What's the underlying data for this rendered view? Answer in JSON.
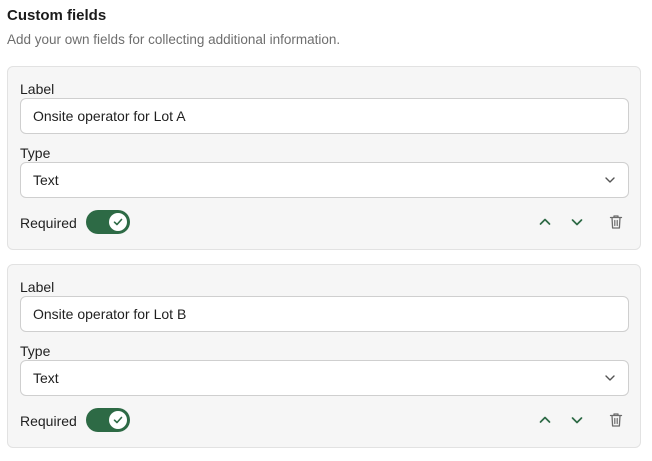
{
  "header": {
    "title": "Custom fields",
    "description": "Add your own fields for collecting additional information."
  },
  "colors": {
    "accent": "#2d6a45",
    "card_bg": "#f6f6f6",
    "border": "#cfcfcf"
  },
  "fields": [
    {
      "label_caption": "Label",
      "label_value": "Onsite operator for Lot A",
      "type_caption": "Type",
      "type_value": "Text",
      "required_caption": "Required",
      "required": true
    },
    {
      "label_caption": "Label",
      "label_value": "Onsite operator for Lot B",
      "type_caption": "Type",
      "type_value": "Text",
      "required_caption": "Required",
      "required": true
    }
  ],
  "icons": {
    "select_arrow": "chevron-down-icon",
    "move_up": "chevron-up-icon",
    "move_down": "chevron-down-icon",
    "delete": "trash-icon",
    "toggle_check": "check-icon"
  }
}
